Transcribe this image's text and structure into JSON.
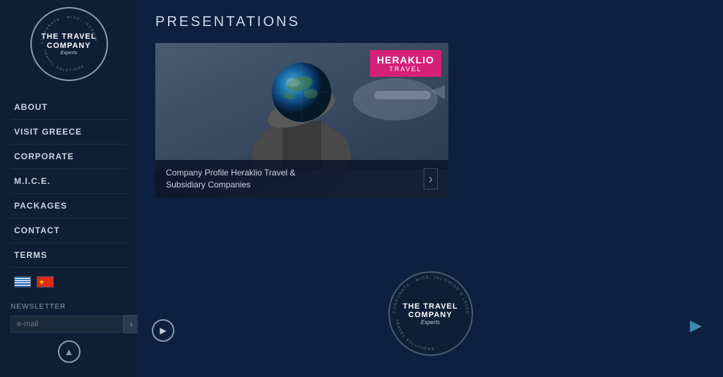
{
  "sidebar": {
    "logo": {
      "line1": "THE TRAVEL",
      "line2": "COMPANY",
      "tagline": "Experts",
      "ring_text": "CORPORATE · MICE, INCOMING & LEISURE · TRAVEL SOLUTIONS"
    },
    "nav_items": [
      {
        "id": "about",
        "label": "ABOUT",
        "active": false
      },
      {
        "id": "visit-greece",
        "label": "VISIT GREECE",
        "active": false
      },
      {
        "id": "corporate",
        "label": "CORPORATE",
        "active": false
      },
      {
        "id": "mice",
        "label": "M.I.C.E.",
        "active": false
      },
      {
        "id": "packages",
        "label": "PACKAGES",
        "active": false
      },
      {
        "id": "contact",
        "label": "CONTACT",
        "active": false
      },
      {
        "id": "terms",
        "label": "TERMS",
        "active": false
      }
    ],
    "languages": [
      {
        "code": "gr",
        "label": "Greek"
      },
      {
        "code": "cn",
        "label": "Chinese"
      }
    ],
    "newsletter": {
      "label": "NEWSLETTER",
      "placeholder": "e-mail",
      "submit_label": "›"
    },
    "scroll_up_label": "▲"
  },
  "main": {
    "page_title": "PRESENTATIONS",
    "card": {
      "title": "Company Profile Heraklio Travel &\nSubsidiary Companies",
      "badge": {
        "name": "HERAKLIO",
        "subtitle": "TRAVEL"
      }
    },
    "bottom_logo": {
      "line1": "THE TRAVEL",
      "line2": "COMPANY",
      "tagline": "Experts"
    },
    "play_label": "▶",
    "next_label": "▶"
  }
}
